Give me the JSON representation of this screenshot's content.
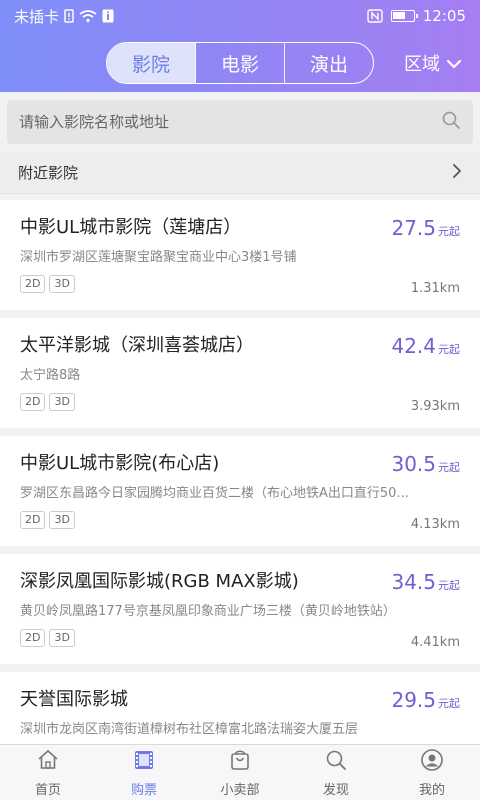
{
  "status": {
    "carrier": "未插卡",
    "time": "12:05"
  },
  "header": {
    "tabs": [
      {
        "label": "影院",
        "active": true
      },
      {
        "label": "电影",
        "active": false
      },
      {
        "label": "演出",
        "active": false
      }
    ],
    "region_label": "区域"
  },
  "search": {
    "placeholder": "请输入影院名称或地址"
  },
  "nearby": {
    "label": "附近影院"
  },
  "cinemas": [
    {
      "name": "中影UL城市影院（莲塘店）",
      "address": "深圳市罗湖区莲塘聚宝路聚宝商业中心3楼1号铺",
      "tags": [
        "2D",
        "3D"
      ],
      "price": "27.5",
      "price_unit": "元起",
      "distance": "1.31km"
    },
    {
      "name": "太平洋影城（深圳喜荟城店）",
      "address": "太宁路8路",
      "tags": [
        "2D",
        "3D"
      ],
      "price": "42.4",
      "price_unit": "元起",
      "distance": "3.93km"
    },
    {
      "name": "中影UL城市影院(布心店)",
      "address": "罗湖区东昌路今日家园腾均商业百货二楼（布心地铁A出口直行50...",
      "tags": [
        "2D",
        "3D"
      ],
      "price": "30.5",
      "price_unit": "元起",
      "distance": "4.13km"
    },
    {
      "name": "深影凤凰国际影城(RGB MAX影城)",
      "address": "黄贝岭凤凰路177号京基凤凰印象商业广场三楼（黄贝岭地铁站）",
      "tags": [
        "2D",
        "3D"
      ],
      "price": "34.5",
      "price_unit": "元起",
      "distance": "4.41km"
    },
    {
      "name": "天誉国际影城",
      "address": "深圳市龙岗区南湾街道樟树布社区樟富北路法瑞姿大厦五层",
      "tags": [],
      "price": "29.5",
      "price_unit": "元起",
      "distance": ""
    }
  ],
  "bottom_nav": [
    {
      "label": "首页",
      "icon": "home-icon",
      "active": false
    },
    {
      "label": "购票",
      "icon": "film-icon",
      "active": true
    },
    {
      "label": "小卖部",
      "icon": "bag-icon",
      "active": false
    },
    {
      "label": "发现",
      "icon": "search-icon",
      "active": false
    },
    {
      "label": "我的",
      "icon": "user-icon",
      "active": false
    }
  ],
  "colors": {
    "accent": "#6f7de6",
    "price": "#6f5fd6"
  }
}
